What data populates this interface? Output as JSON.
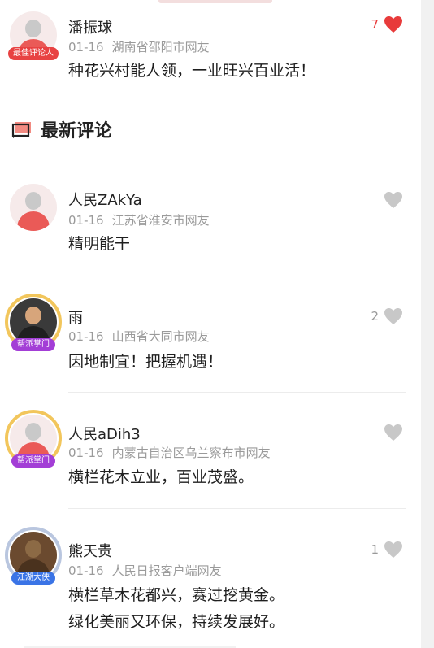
{
  "colors": {
    "accent": "#e84242",
    "muted": "#9a9a9a",
    "like_inactive": "#c8c8c8"
  },
  "best_comment": {
    "user": "潘振球",
    "badge": "最佳评论人",
    "date": "01-16",
    "location": "湖南省邵阳市网友",
    "likes": "7",
    "liked": true,
    "text": "种花兴村能人领，一业旺兴百业活！"
  },
  "section": {
    "title": "最新评论",
    "icon": "comment-icon"
  },
  "comments": [
    {
      "user": "人民ZAkYa",
      "date": "01-16",
      "location": "江苏省淮安市网友",
      "likes": "",
      "text_lines": [
        "精明能干"
      ]
    },
    {
      "user": "雨",
      "badge": "帮派掌门",
      "date": "01-16",
      "location": "山西省大同市网友",
      "likes": "2",
      "text_lines": [
        "因地制宜！把握机遇！"
      ]
    },
    {
      "user": "人民aDih3",
      "badge": "帮派掌门",
      "date": "01-16",
      "location": "内蒙古自治区乌兰察布市网友",
      "likes": "",
      "text_lines": [
        "横栏花木立业，百业茂盛。"
      ]
    },
    {
      "user": "熊天贵",
      "badge": "江湖大侠",
      "date": "01-16",
      "location": "人民日报客户端网友",
      "likes": "1",
      "text_lines": [
        "横栏草木花都兴，赛过挖黄金。",
        "绿化美丽又环保，持续发展好。"
      ]
    }
  ]
}
